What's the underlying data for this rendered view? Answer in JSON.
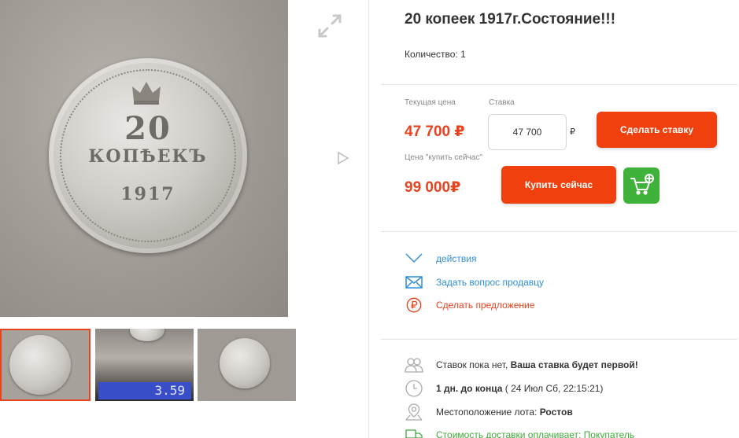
{
  "lot": {
    "title": "20 копеек 1917г.Состояние!!!",
    "quantity": "Количество: 1"
  },
  "coin": {
    "denomination": "20",
    "word": "КОПѢЕКЪ",
    "year": "1917"
  },
  "gallery": {
    "scale_reading": "3.59"
  },
  "pricing": {
    "current_label": "Текущая цена",
    "current_price": "47 700 ₽",
    "bid_label": "Ставка",
    "bid_value": "47 700",
    "bid_currency": "₽",
    "bid_button": "Сделать ставку",
    "buynow_label": "Цена \"купить сейчас\"",
    "buynow_price": "99 000₽",
    "buy_button": "Купить сейчас"
  },
  "actions": [
    {
      "label": "действия",
      "icon": "chevron-down-icon"
    },
    {
      "label": "Задать вопрос продавцу",
      "icon": "envelope-icon"
    },
    {
      "label": "Сделать предложение",
      "icon": "ruble-circle-icon"
    }
  ],
  "info": {
    "bids_prefix": "Ставок пока нет, ",
    "bids_strong": "Ваша ставка будет первой!",
    "time_strong": "1 дн. до конца",
    "time_rest": " ( 24 Июл Сб, 22:15:21)",
    "location_prefix": "Местоположение лота: ",
    "location_strong": "Ростов",
    "delivery": "Стоимость доставки оплачивает: Покупатель"
  },
  "colors": {
    "accent": "#f0400e",
    "price": "#e8431f",
    "link": "#2f8fd8",
    "cart": "#3fb23a"
  }
}
